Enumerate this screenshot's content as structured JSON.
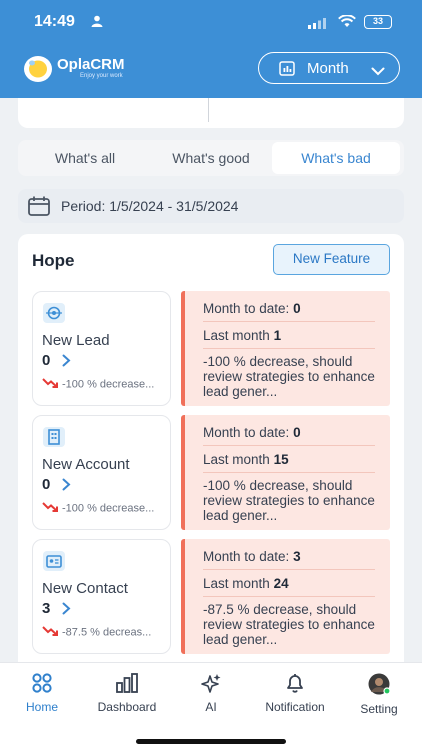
{
  "status_bar": {
    "time": "14:49",
    "battery": "33"
  },
  "header": {
    "brand": "OplaCRM",
    "tagline": "Enjoy your work",
    "period_select": "Month"
  },
  "filters": {
    "tabs": [
      "What's all",
      "What's good",
      "What's bad"
    ],
    "active_tab": "What's bad"
  },
  "period": {
    "label": "Period: 1/5/2024 - 31/5/2024"
  },
  "hope": {
    "title": "Hope",
    "new_feature_label": "New Feature",
    "metrics": [
      {
        "name": "New Lead",
        "value": "0",
        "trend": "-100 % decrease...",
        "icon": "lead-icon",
        "month_to_date_label": "Month to date:",
        "month_to_date": "0",
        "last_month_label": "Last month",
        "last_month": "1",
        "message": "-100 % decrease, should review strategies to enhance lead gener..."
      },
      {
        "name": "New Account",
        "value": "0",
        "trend": "-100 % decrease...",
        "icon": "building-icon",
        "month_to_date_label": "Month to date:",
        "month_to_date": "0",
        "last_month_label": "Last month",
        "last_month": "15",
        "message": "-100 % decrease, should review strategies to enhance lead gener..."
      },
      {
        "name": "New Contact",
        "value": "3",
        "trend": "-87.5 % decreas...",
        "icon": "contact-card-icon",
        "month_to_date_label": "Month to date:",
        "month_to_date": "3",
        "last_month_label": "Last month",
        "last_month": "24",
        "message": "-87.5 % decrease, should review strategies to enhance lead gener..."
      }
    ]
  },
  "nav": {
    "items": [
      {
        "label": "Home",
        "icon": "grid-icon"
      },
      {
        "label": "Dashboard",
        "icon": "bar-chart-icon"
      },
      {
        "label": "AI",
        "icon": "sparkle-icon"
      },
      {
        "label": "Notification",
        "icon": "bell-icon"
      },
      {
        "label": "Setting",
        "icon": "avatar"
      }
    ],
    "active": "Home"
  },
  "colors": {
    "brand_blue": "#3d8fd6",
    "bad_bg": "#fde7e2",
    "bad_accent": "#f0705a",
    "trend_red": "#e53935"
  }
}
